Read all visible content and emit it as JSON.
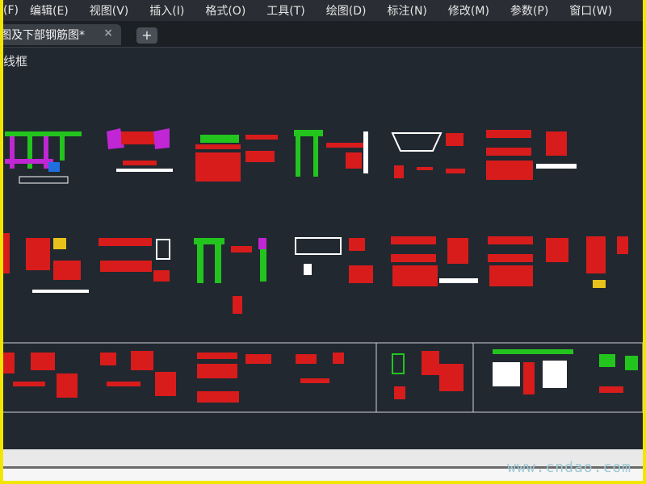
{
  "menubar": {
    "items": [
      "(F)",
      "编辑(E)",
      "视图(V)",
      "插入(I)",
      "格式(O)",
      "工具(T)",
      "绘图(D)",
      "标注(N)",
      "修改(M)",
      "参数(P)",
      "窗口(W)"
    ]
  },
  "tabs": {
    "active_label": "图及下部钢筋图*",
    "close_symbol": "×",
    "new_tab_symbol": "+"
  },
  "viewport": {
    "visual_style": "线框"
  },
  "watermark": "www.cndao.com",
  "colors": {
    "background": "#212830",
    "accent_red": "#d81c1c",
    "accent_green": "#23c41d",
    "accent_magenta": "#c026d3",
    "accent_yellow": "#e8c21a",
    "frame": "#f2e600"
  }
}
